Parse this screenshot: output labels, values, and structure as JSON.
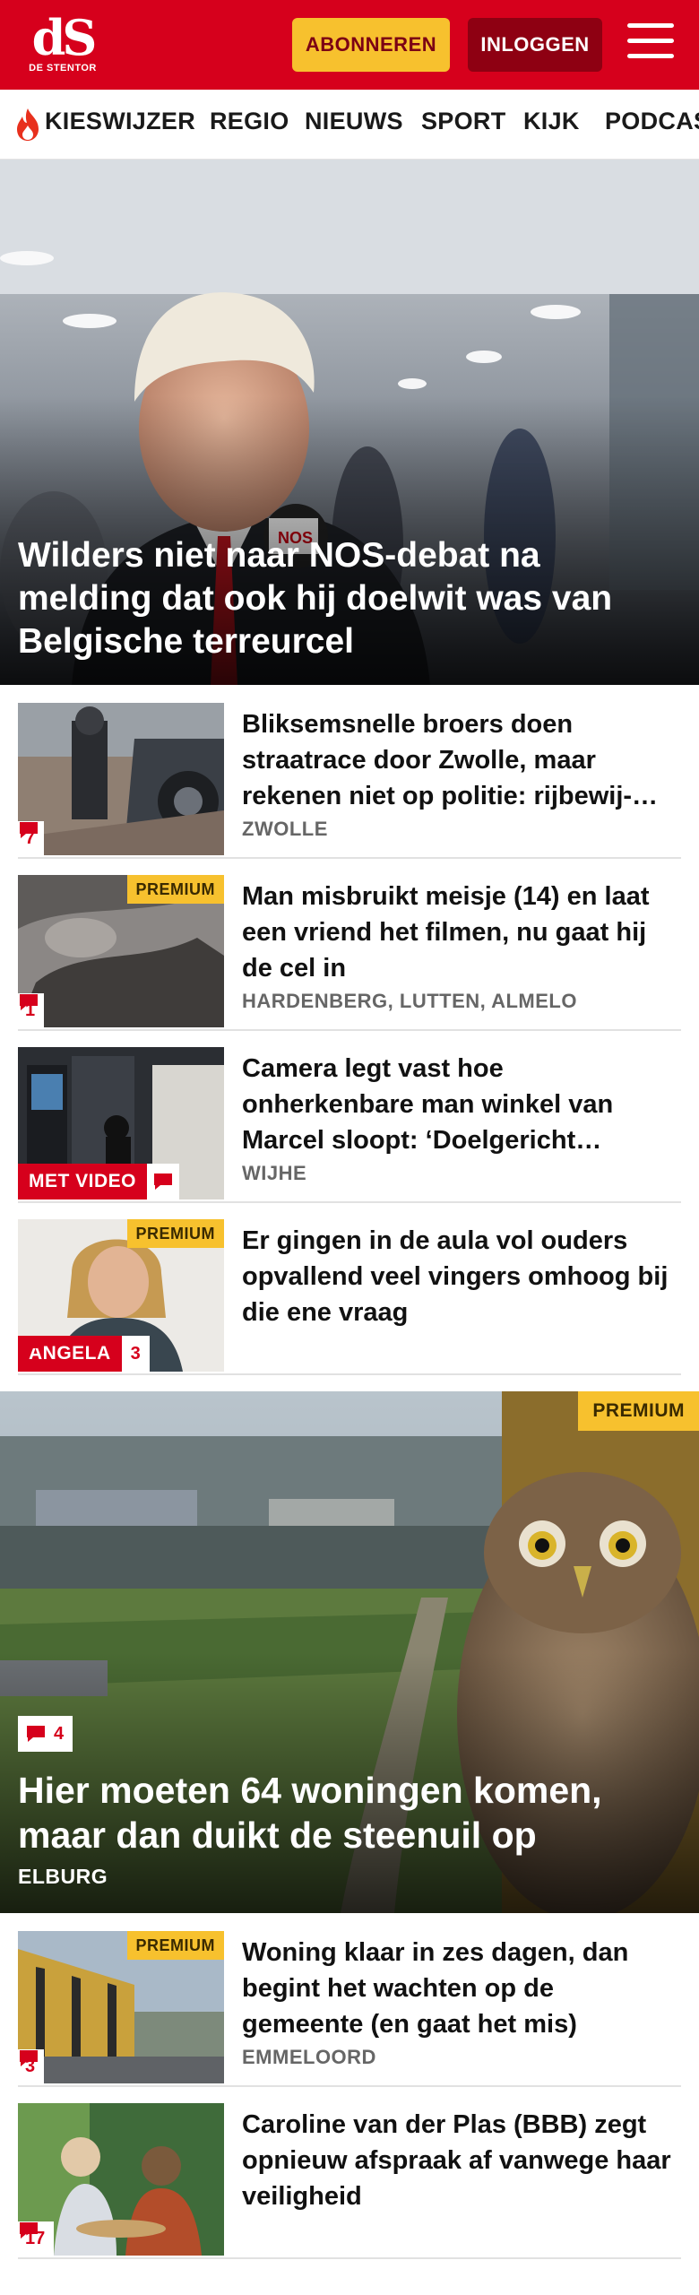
{
  "header": {
    "logo_text": "dS",
    "logo_sub": "DE STENTOR",
    "subscribe_label": "ABONNEREN",
    "login_label": "INLOGGEN",
    "brand_color": "#d6001c"
  },
  "nav": {
    "items": [
      "KIESWIJZER",
      "REGIO",
      "NIEUWS",
      "SPORT",
      "KIJK",
      "PODCAST"
    ]
  },
  "hero": {
    "title": "Wilders niet naar NOS-debat na melding dat ook hij doelwit was van Belgische terreurcel"
  },
  "articles": [
    {
      "title": "Bliksemsnelle broers doen straatrace door Zwolle, maar rekenen niet op politie: rijbewij-…",
      "location": "ZWOLLE",
      "comments": "7",
      "premium": ""
    },
    {
      "title": "Man misbruikt meisje (14) en laat een vriend het filmen, nu gaat hij de cel in",
      "location": "HARDENBERG, LUTTEN, ALMELO",
      "comments": "1",
      "premium": "PREMIUM"
    },
    {
      "title": "Camera legt vast hoe onherkenbare man winkel van Marcel sloopt: ‘Doelgericht…",
      "location": "WIJHE",
      "label": "MET VIDEO",
      "premium": ""
    },
    {
      "title": "Er gingen in de aula vol ouders opvallend veel vingers omhoog bij die ene vraag",
      "location": "",
      "label": "ANGELA",
      "comments": "3",
      "premium": "PREMIUM"
    }
  ],
  "feature": {
    "title": "Hier moeten 64 woningen komen, maar dan duikt de steenuil op",
    "location": "ELBURG",
    "comments": "4",
    "premium": "PREMIUM"
  },
  "articles2": [
    {
      "title": "Woning klaar in zes dagen, dan begint het wachten op de gemeente (en gaat het mis)",
      "location": "EMMELOORD",
      "comments": "3",
      "premium": "PREMIUM"
    },
    {
      "title": "Caroline van der Plas (BBB) zegt opnieuw afspraak af vanwege haar veiligheid",
      "location": "",
      "comments": "17",
      "premium": ""
    }
  ],
  "icons": {
    "menu": "hamburger-icon",
    "trending": "flame-icon",
    "comments": "comment-bubble-icon"
  }
}
